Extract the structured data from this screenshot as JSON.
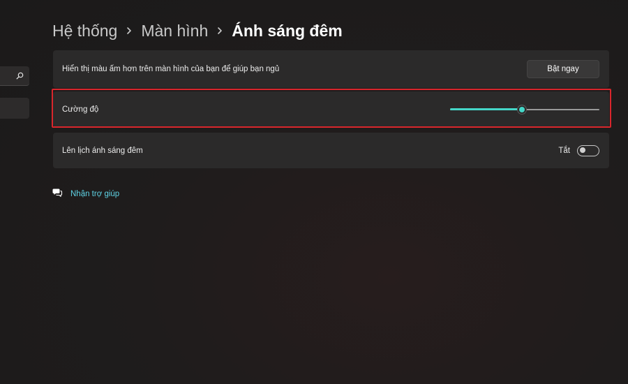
{
  "colors": {
    "accent": "#45d7c8",
    "link": "#5fd4e6",
    "highlight_border": "#d9262c",
    "card_bg": "#2b2a2a"
  },
  "sidebar": {
    "search_icon": "search-icon"
  },
  "breadcrumb": {
    "items": [
      "Hệ thống",
      "Màn hình"
    ],
    "current": "Ánh sáng đêm",
    "separator_icon": "chevron-right-icon"
  },
  "settings": {
    "warm_color": {
      "label": "Hiển thị màu ấm hơn trên màn hình của bạn để giúp bạn ngủ",
      "button_label": "Bật ngay"
    },
    "strength": {
      "label": "Cường độ",
      "value_fraction": 0.48
    },
    "schedule": {
      "label": "Lên lịch ánh sáng đêm",
      "state_label": "Tắt",
      "enabled": false
    }
  },
  "help": {
    "icon": "help-chat-icon",
    "label": "Nhận trợ giúp"
  }
}
